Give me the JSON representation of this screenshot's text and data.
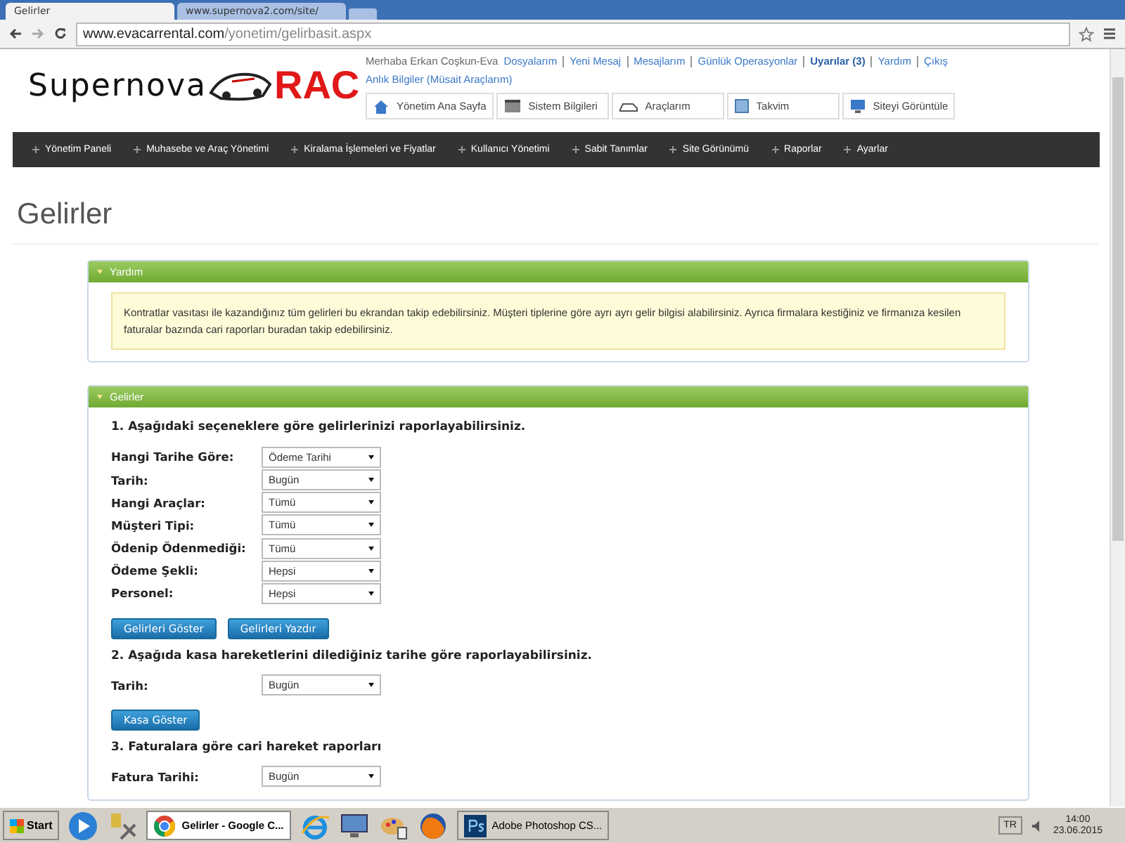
{
  "browser": {
    "tabs": [
      {
        "label": "Gelirler",
        "selected": true
      },
      {
        "label": "www.supernova2.com/site/",
        "selected": false
      }
    ],
    "address": {
      "host": "www.evacarrental.com",
      "path": "/yonetim/gelirbasit.aspx"
    }
  },
  "header": {
    "logo": {
      "word": "Supernova",
      "mark": "RAC"
    },
    "greeting": "Merhaba Erkan Coşkun-Eva",
    "links": [
      {
        "label": "Dosyalarım",
        "emphasized": false
      },
      {
        "label": "Yeni Mesaj",
        "emphasized": false
      },
      {
        "label": "Mesajlarım",
        "emphasized": false
      },
      {
        "label": "Günlük Operasyonlar",
        "emphasized": false
      },
      {
        "label": "Uyarılar (3)",
        "emphasized": true
      },
      {
        "label": "Yardım",
        "emphasized": false
      },
      {
        "label": "Çıkış",
        "emphasized": false
      }
    ],
    "info_link": "Anlık Bilgiler (Müsait Araçlarım)",
    "quick_buttons": [
      {
        "label": "Yönetim Ana Sayfa",
        "kind": "home"
      },
      {
        "label": "Sistem Bilgileri",
        "kind": "info"
      },
      {
        "label": "Araçlarım",
        "kind": "car"
      },
      {
        "label": "Takvim",
        "kind": "calendar"
      },
      {
        "label": "Siteyi Görüntüle",
        "kind": "monitor"
      }
    ]
  },
  "nav": [
    "Yönetim Paneli",
    "Muhasebe ve Araç Yönetimi",
    "Kiralama İşlemeleri ve Fiyatlar",
    "Kullanıcı Yönetimi",
    "Sabit Tanımlar",
    "Site Görünümü",
    "Raporlar",
    "Ayarlar"
  ],
  "page_title": "Gelirler",
  "help_panel": {
    "title": "Yardım",
    "text": "Kontratlar vasıtası ile kazandığınız tüm gelirleri bu ekrandan takip edebilirsiniz. Müşteri tiplerine göre ayrı ayrı gelir bilgisi alabilirsiniz. Ayrıca firmalara kestiğiniz ve firmanıza kesilen faturalar bazında cari raporları buradan takip edebilirsiniz."
  },
  "income_panel": {
    "title": "Gelirler",
    "sections": [
      {
        "heading": "1. Aşağıdaki seçeneklere göre gelirlerinizi raporlayabilirsiniz.",
        "fields": [
          {
            "label": "Hangi Tarihe Göre:",
            "value": "Ödeme Tarihi"
          },
          {
            "label": "Tarih:",
            "value": "Bugün"
          },
          {
            "label": "Hangi Araçlar:",
            "value": "Tümü"
          },
          {
            "label": "Müşteri Tipi:",
            "value": "Tümü"
          },
          {
            "label": "Ödenip Ödenmediği:",
            "value": "Tümü"
          },
          {
            "label": "Ödeme Şekli:",
            "value": "Hepsi"
          },
          {
            "label": "Personel:",
            "value": "Hepsi"
          }
        ],
        "buttons": [
          "Gelirleri Göster",
          "Gelirleri Yazdır"
        ]
      },
      {
        "heading": "2. Aşağıda kasa hareketlerini dilediğiniz tarihe göre raporlayabilirsiniz.",
        "fields": [
          {
            "label": "Tarih:",
            "value": "Bugün"
          }
        ],
        "buttons": [
          "Kasa Göster"
        ]
      },
      {
        "heading": "3. Faturalara göre cari hareket raporları",
        "fields": [
          {
            "label": "Fatura Tarihi:",
            "value": "Bugün"
          }
        ]
      }
    ]
  },
  "taskbar": {
    "start": "Start",
    "items": [
      {
        "kind": "media"
      },
      {
        "kind": "tool"
      },
      {
        "kind": "chrome",
        "label": "Gelirler - Google C...",
        "selected": true
      },
      {
        "kind": "ie"
      },
      {
        "kind": "remote"
      },
      {
        "kind": "paint"
      },
      {
        "kind": "firefox"
      },
      {
        "kind": "photoshop",
        "label": "Adobe Photoshop CS...",
        "selected": false
      }
    ],
    "language": "TR",
    "time": "14:00",
    "date": "23.06.2015"
  }
}
